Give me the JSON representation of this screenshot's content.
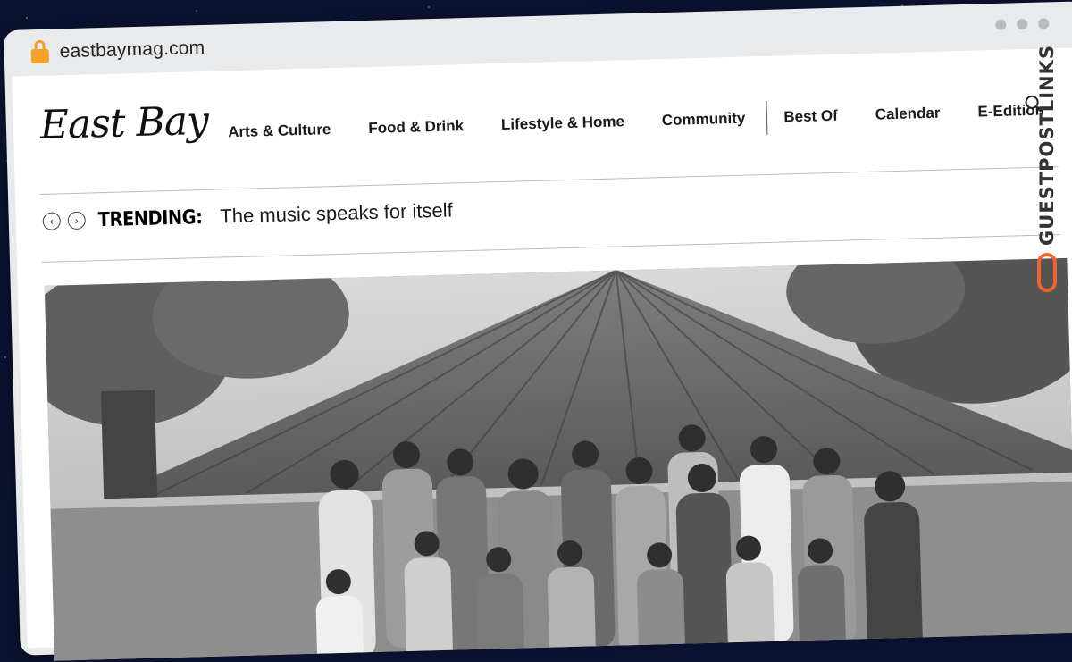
{
  "browser": {
    "url": "eastbaymag.com"
  },
  "site": {
    "logo_text": "East Bay",
    "nav": [
      {
        "label": "Arts & Culture"
      },
      {
        "label": "Food & Drink"
      },
      {
        "label": "Lifestyle & Home"
      },
      {
        "label": "Community"
      },
      {
        "label": "Best Of"
      },
      {
        "label": "Calendar"
      },
      {
        "label": "E-Edition"
      }
    ],
    "trending": {
      "label": "TRENDING:",
      "headline": "The music speaks for itself"
    }
  },
  "watermark": {
    "text": "GUESTPOSTLINKS",
    "accent": "#f0632a"
  }
}
